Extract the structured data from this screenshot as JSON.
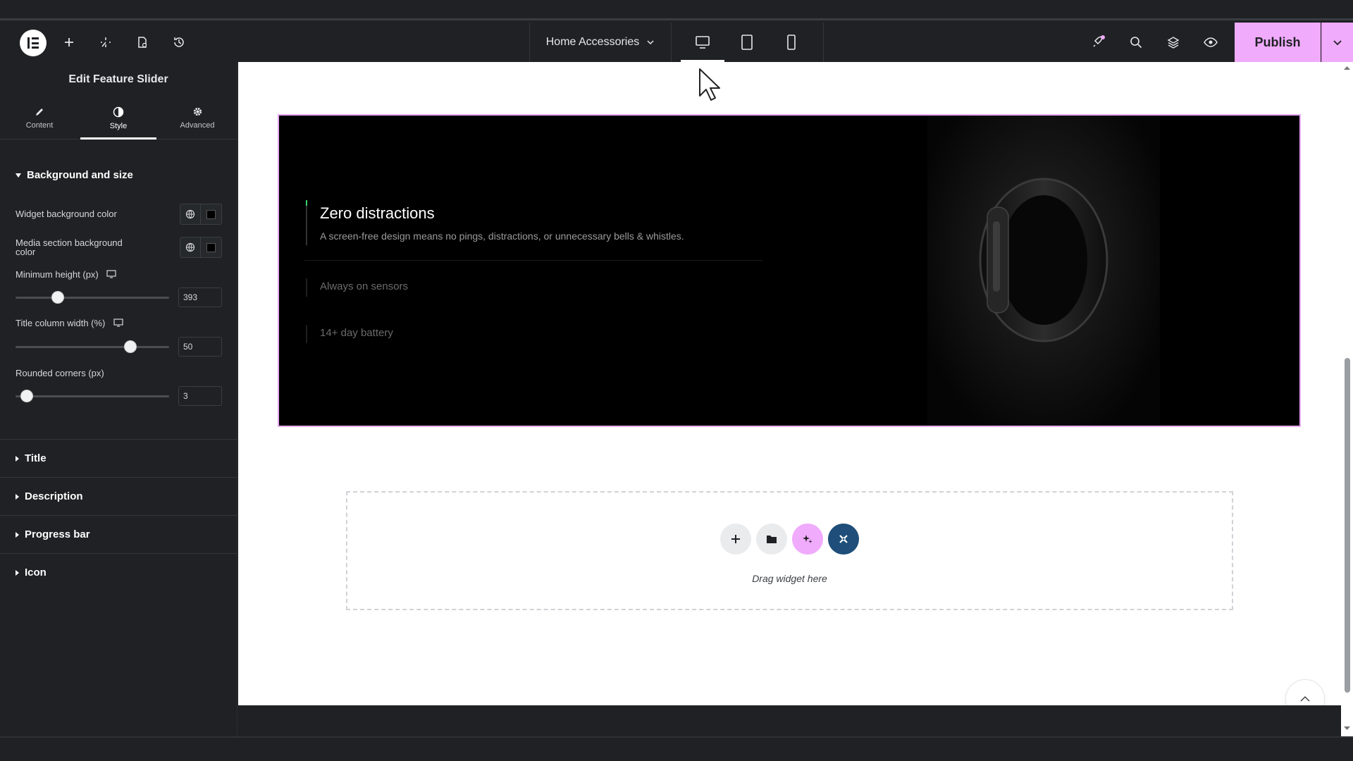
{
  "topbar": {
    "page_name": "Home Accessories",
    "publish_label": "Publish"
  },
  "panel": {
    "title": "Edit Feature Slider",
    "tabs": [
      {
        "label": "Content",
        "icon": "pencil-icon"
      },
      {
        "label": "Style",
        "icon": "half-circle-icon"
      },
      {
        "label": "Advanced",
        "icon": "gear-icon"
      }
    ],
    "active_tab": "Style",
    "section_open": "Background and size",
    "controls": {
      "widget_bg_label": "Widget background color",
      "media_bg_label_1": "Media section background",
      "media_bg_label_2": "color",
      "min_height_label": "Minimum height (px)",
      "min_height_value": "393",
      "title_width_label": "Title column width (%)",
      "title_width_value": "50",
      "rounded_label": "Rounded corners (px)",
      "rounded_value": "3"
    },
    "collapsed_sections": [
      "Title",
      "Description",
      "Progress bar",
      "Icon"
    ]
  },
  "canvas": {
    "features": [
      {
        "title": "Zero distractions",
        "description": "A screen-free design means no pings, distractions, or unnecessary bells & whistles."
      },
      {
        "title": "Always on sensors"
      },
      {
        "title": "14+ day battery"
      }
    ],
    "drop_text": "Drag widget here"
  },
  "colors": {
    "publish": "#f0abfc",
    "ai_button": "#f0abfc",
    "template_button": "#1e4e79",
    "progress_accent": "#39d26b"
  }
}
